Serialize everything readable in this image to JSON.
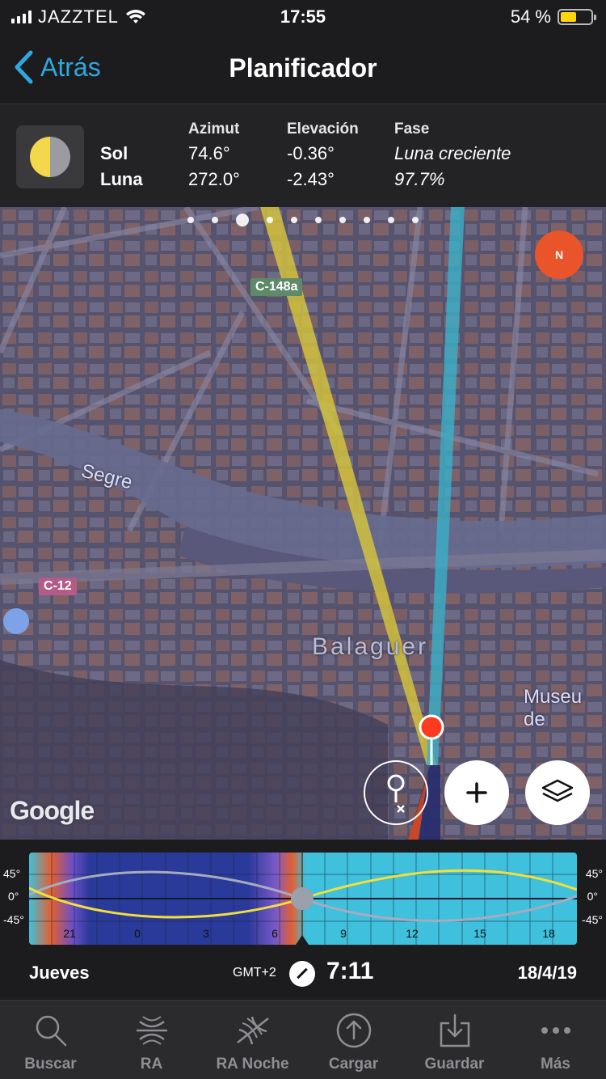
{
  "status": {
    "carrier": "JAZZTEL",
    "time": "17:55",
    "battery": "54 %",
    "battery_level": 0.54
  },
  "nav": {
    "back_label": "Atrás",
    "title": "Planificador"
  },
  "info": {
    "headers": {
      "azimut": "Azimut",
      "elevacion": "Elevación",
      "fase": "Fase"
    },
    "sol": {
      "label": "Sol",
      "azimut": "74.6°",
      "elevacion": "-0.36°",
      "fase": "Luna creciente"
    },
    "luna": {
      "label": "Luna",
      "azimut": "272.0°",
      "elevacion": "-2.43°",
      "fase": "97.7%"
    }
  },
  "map": {
    "road_c148": "C-148a",
    "road_c12": "C-12",
    "river": "Segre",
    "town": "Balaguer",
    "poi": "Museu de",
    "google": "Google",
    "compass_letter": "N",
    "pager_count": 10,
    "pager_active": 2,
    "sun_color": "#d8c83a",
    "moon_color": "#3ab0c8"
  },
  "timeline": {
    "y_labels": [
      "45°",
      "0°",
      "-45°"
    ],
    "hours": [
      "21",
      "0",
      "3",
      "6",
      "9",
      "12",
      "15",
      "18"
    ]
  },
  "dateline": {
    "day": "Jueves",
    "gmt": "GMT+2",
    "time": "7:11",
    "date": "18/4/19"
  },
  "tabs": [
    {
      "label": "Buscar",
      "icon": "search-icon"
    },
    {
      "label": "RA",
      "icon": "ar-icon"
    },
    {
      "label": "RA Noche",
      "icon": "ar-night-icon"
    },
    {
      "label": "Cargar",
      "icon": "upload-icon"
    },
    {
      "label": "Guardar",
      "icon": "save-icon"
    },
    {
      "label": "Más",
      "icon": "more-icon"
    }
  ]
}
